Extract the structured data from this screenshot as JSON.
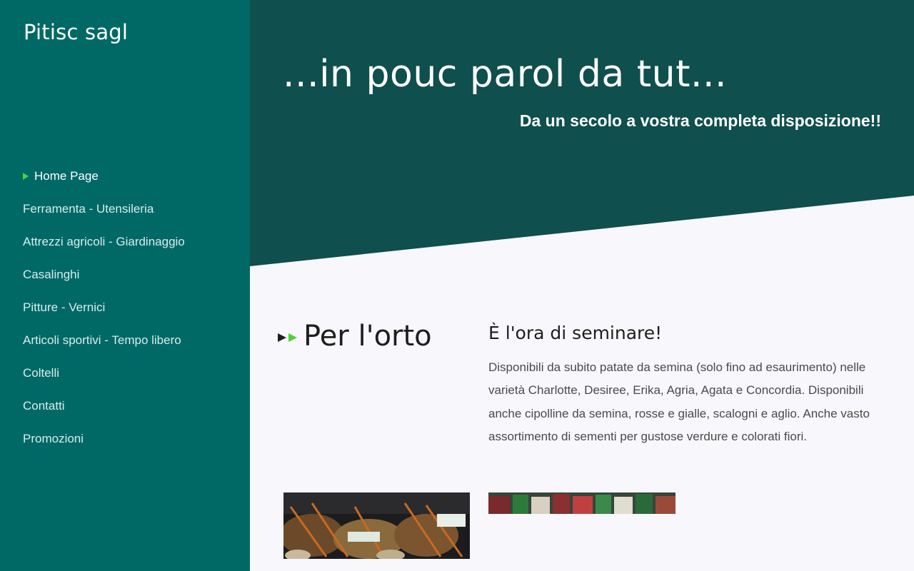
{
  "site": {
    "title": "Pitisc sagl"
  },
  "nav": {
    "items": [
      {
        "label": "Home Page",
        "active": true
      },
      {
        "label": "Ferramenta - Utensileria"
      },
      {
        "label": "Attrezzi agricoli - Giardinaggio"
      },
      {
        "label": "Casalinghi"
      },
      {
        "label": "Pitture - Vernici"
      },
      {
        "label": "Articoli sportivi - Tempo libero"
      },
      {
        "label": "Coltelli"
      },
      {
        "label": "Contatti"
      },
      {
        "label": "Promozioni"
      }
    ]
  },
  "hero": {
    "title": "...in pouc parol da tut...",
    "subtitle": "Da un secolo a vostra completa disposizione!!"
  },
  "section": {
    "heading": "Per l'orto"
  },
  "article": {
    "title": "È l'ora di seminare!",
    "body": "Disponibili da subito patate da semina (solo fino ad esaurimento) nelle varietà Charlotte, Desiree, Erika, Agria, Agata e Concordia. Disponibili anche cipolline da semina, rosse e gialle, scalogni e aglio. Anche vasto assortimento di sementi per gustose verdure e colorati fiori."
  },
  "icons": {
    "nav_active": "triangle-right-icon",
    "section_heading": "double-arrow-icon"
  },
  "colors": {
    "sidebar": "#006966",
    "hero": "#0f4f4e",
    "content_bg": "#f8f8fc",
    "accent": "#4cd137"
  }
}
